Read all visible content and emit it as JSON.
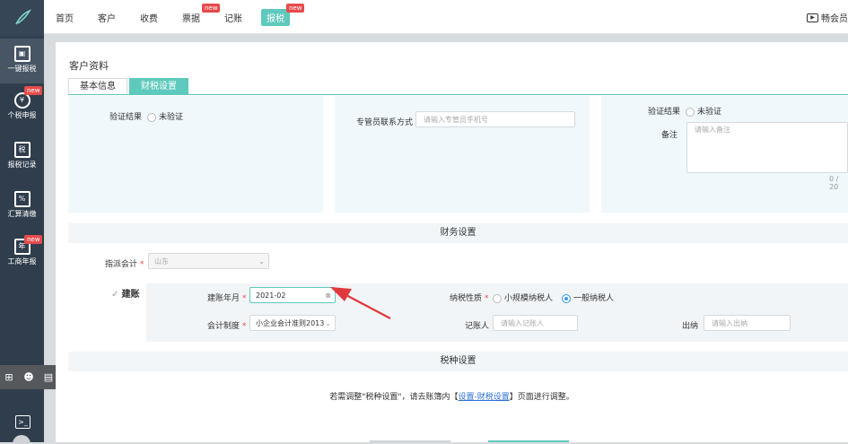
{
  "sidebar": {
    "items": [
      {
        "label": "一键报税",
        "new": false
      },
      {
        "label": "个税申报",
        "new": true
      },
      {
        "label": "报税记录",
        "new": false
      },
      {
        "label": "汇算清缴",
        "new": false
      },
      {
        "label": "工商年报",
        "new": true
      }
    ],
    "new_badge": "new"
  },
  "topnav": {
    "items": [
      {
        "label": "首页",
        "new": false
      },
      {
        "label": "客户",
        "new": false
      },
      {
        "label": "收费",
        "new": false
      },
      {
        "label": "票据",
        "new": true
      },
      {
        "label": "记账",
        "new": false
      },
      {
        "label": "报税",
        "new": true,
        "active": true
      }
    ],
    "right_text": "畅会员"
  },
  "page": {
    "title": "客户资料",
    "tabs": [
      "基本信息",
      "财税设置"
    ],
    "active_tab": "财税设置"
  },
  "verify1": {
    "label": "验证结果",
    "value": "未验证"
  },
  "contact": {
    "label": "专管员联系方式",
    "placeholder": "请输入专管员手机号"
  },
  "verify2": {
    "label": "验证结果",
    "value": "未验证"
  },
  "remark": {
    "label": "备注",
    "placeholder": "请输入备注",
    "counter": "0 / 20"
  },
  "finance": {
    "section_title": "财务设置",
    "assign_label": "指派会计",
    "assign_value": "山东",
    "jianzhang_label": "建账",
    "month_label": "建账年月",
    "month_value": "2021-02",
    "tax_nature_label": "纳税性质",
    "tax_nature_options": [
      "小规模纳税人",
      "一般纳税人"
    ],
    "tax_nature_selected": "一般纳税人",
    "system_label": "会计制度",
    "system_value": "小企业会计准则2013",
    "bookkeeper_label": "记账人",
    "bookkeeper_placeholder": "请输入记账人",
    "cashier_label": "出纳",
    "cashier_placeholder": "请输入出纳"
  },
  "tax": {
    "section_title": "税种设置",
    "notice_before": "若需调整\"税种设置\"，请去账簿内【",
    "notice_link": "设置-财税设置",
    "notice_after": "】页面进行调整。"
  },
  "colors": {
    "accent": "#5ec9bd",
    "sidebar": "#2f3d4c",
    "badge": "#e64b4b",
    "arrow": "#e0393d"
  }
}
